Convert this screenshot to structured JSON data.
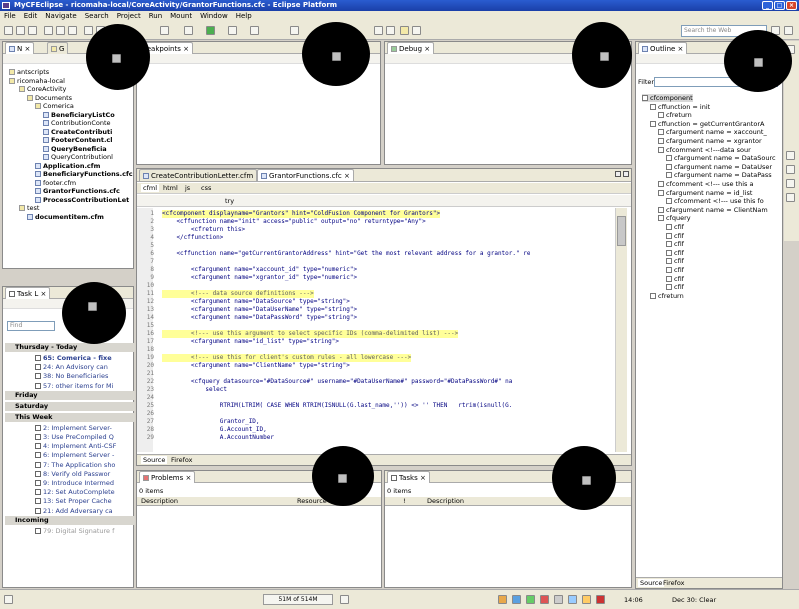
{
  "window": {
    "title": "MyCFEclipse - ricomaha-local/CoreActivity/GrantorFunctions.cfc - Eclipse Platform"
  },
  "menu": [
    "File",
    "Edit",
    "Navigate",
    "Search",
    "Project",
    "Run",
    "Mount",
    "Window",
    "Help"
  ],
  "search": {
    "placeholder": "Search the Web"
  },
  "navigator": {
    "tab": "N",
    "tab2": "G",
    "tree": [
      {
        "label": "antscripts",
        "type": "folder",
        "bold": false
      },
      {
        "label": "ricomaha-local",
        "type": "folder",
        "bold": false
      },
      {
        "label": "CoreActivity",
        "type": "folder",
        "bold": false
      },
      {
        "label": "Documents",
        "type": "folder",
        "bold": false
      },
      {
        "label": "Comerica",
        "type": "folder",
        "bold": false
      },
      {
        "label": "BeneficiaryListCo",
        "type": "file",
        "bold": true
      },
      {
        "label": "ContributionConte",
        "type": "file",
        "bold": false
      },
      {
        "label": "CreateContributi",
        "type": "file",
        "bold": true
      },
      {
        "label": "FooterContent.cl",
        "type": "file",
        "bold": true
      },
      {
        "label": "QueryBeneficia",
        "type": "file",
        "bold": true
      },
      {
        "label": "QueryContributionl",
        "type": "file",
        "bold": false
      },
      {
        "label": "Application.cfm",
        "type": "file",
        "bold": true
      },
      {
        "label": "BeneficiaryFunctions.cfc",
        "type": "file",
        "bold": true
      },
      {
        "label": "footer.cfm",
        "type": "file",
        "bold": false
      },
      {
        "label": "GrantorFunctions.cfc",
        "type": "file",
        "bold": true
      },
      {
        "label": "ProcessContributionLet",
        "type": "file",
        "bold": true
      },
      {
        "label": "test",
        "type": "folder",
        "bold": false
      },
      {
        "label": "documentitem.cfm",
        "type": "file",
        "bold": true
      }
    ]
  },
  "breakpoints": {
    "tab": "reakpoints"
  },
  "debug": {
    "tab": "Debug"
  },
  "outline": {
    "tab": "Outline",
    "filter_label": "Filter",
    "items": [
      "cfcomponent",
      "cffunction = init",
      "cfreturn",
      "cffunction = getCurrentGrantorA",
      "cfargument name = xaccount_",
      "cfargument name = xgrantor",
      "cfcomment <!---data sour",
      "cfargument name = DataSourc",
      "cfargument name = DataUser",
      "cfargument name = DataPass",
      "cfcomment <!--- use this a",
      "cfargument name = id_list",
      "cfcomment <!--- use this fo",
      "cfargument name = ClientNam",
      "cfquery",
      "cfif",
      "cfif",
      "cfif",
      "cfif",
      "cfif",
      "cfif",
      "cfif",
      "cfif",
      "cfreturn"
    ],
    "bottom_tabs": [
      "Source",
      "Firefox"
    ]
  },
  "editor": {
    "tabs": [
      "CreateContributionLetter.cfm",
      "GrantorFunctions.cfc"
    ],
    "mode_tabs": [
      "cfml",
      "html",
      "js",
      "css"
    ],
    "toolbar_text": "try",
    "bottom_tabs": [
      "Source",
      "Firefox"
    ],
    "lines": [
      {
        "n": "1",
        "text": "<cfcomponent displayname=\"Grantors\" hint=\"ColdFusion Component for Grantors\">"
      },
      {
        "n": "2",
        "text": "    <cffunction name=\"init\" access=\"public\" output=\"no\" returntype=\"Any\">"
      },
      {
        "n": "3",
        "text": "        <cfreturn this>"
      },
      {
        "n": "4",
        "text": "    </cffunction>"
      },
      {
        "n": "5",
        "text": ""
      },
      {
        "n": "6",
        "text": "    <cffunction name=\"getCurrentGrantorAddress\" hint=\"Get the most relevant address for a grantor.\" re"
      },
      {
        "n": "7",
        "text": ""
      },
      {
        "n": "8",
        "text": "        <cfargument name=\"xaccount_id\" type=\"numeric\">"
      },
      {
        "n": "9",
        "text": "        <cfargument name=\"xgrantor_id\" type=\"numeric\">"
      },
      {
        "n": "10",
        "text": ""
      },
      {
        "n": "11",
        "text": "        <!--- data source definitions --->"
      },
      {
        "n": "12",
        "text": "        <cfargument name=\"DataSource\" type=\"string\">"
      },
      {
        "n": "13",
        "text": "        <cfargument name=\"DataUserName\" type=\"string\">"
      },
      {
        "n": "14",
        "text": "        <cfargument name=\"DataPassWord\" type=\"string\">"
      },
      {
        "n": "15",
        "text": ""
      },
      {
        "n": "16",
        "text": "        <!--- use this argument to select specific IDs (comma-delimited list) --->"
      },
      {
        "n": "17",
        "text": "        <cfargument name=\"id_list\" type=\"string\">"
      },
      {
        "n": "18",
        "text": ""
      },
      {
        "n": "19",
        "text": "        <!--- use this for client's custom rules - all lowercase --->"
      },
      {
        "n": "20",
        "text": "        <cfargument name=\"ClientName\" type=\"string\">"
      },
      {
        "n": "21",
        "text": ""
      },
      {
        "n": "22",
        "text": "        <cfquery datasource=\"#DataSource#\" username=\"#DataUserName#\" password=\"#DataPassWord#\" na"
      },
      {
        "n": "23",
        "text": "            select"
      },
      {
        "n": "24",
        "text": ""
      },
      {
        "n": "25",
        "text": "                RTRIM(LTRIM( CASE WHEN RTRIM(ISNULL(G.last_name,'')) <> '' THEN   rtrim(isnull(G."
      },
      {
        "n": "26",
        "text": ""
      },
      {
        "n": "27",
        "text": "                Grantor_ID,"
      },
      {
        "n": "28",
        "text": "                G.Account_ID,"
      },
      {
        "n": "29",
        "text": "                A.AccountNumber"
      }
    ]
  },
  "tasklist": {
    "tab": "Task L",
    "find_placeholder": "Find",
    "groups": [
      {
        "label": "Thursday - Today",
        "items": [
          "65: Comerica - fixe",
          "24: An Advisory can",
          "38: No Beneficiaries",
          "57: other items for Mi"
        ]
      },
      {
        "label": "Friday",
        "items": []
      },
      {
        "label": "Saturday",
        "items": []
      },
      {
        "label": "This Week",
        "items": [
          "2: Implement Server-",
          "3: Use PreCompiled Q",
          "4: Implement Anti-CSF",
          "6: Implement Server -",
          "7: The Application sho",
          "8: Verify old Passwor",
          "9: Introduce Intermed",
          "12: Set AutoComplete",
          "13: Set Proper Cache",
          "21: Add Adversary ca"
        ]
      },
      {
        "label": "Incoming",
        "items": [
          "79: Digital Signature f"
        ]
      }
    ]
  },
  "problems": {
    "tab": "Problems",
    "count": "0 items",
    "columns": [
      "Description",
      "Resource"
    ]
  },
  "tasks": {
    "tab": "Tasks",
    "count": "0 items",
    "columns": [
      "!",
      "Description"
    ]
  },
  "status": {
    "memory": "51M of 514M",
    "time": "14:06",
    "date_text": "Dec 30: Clear"
  }
}
